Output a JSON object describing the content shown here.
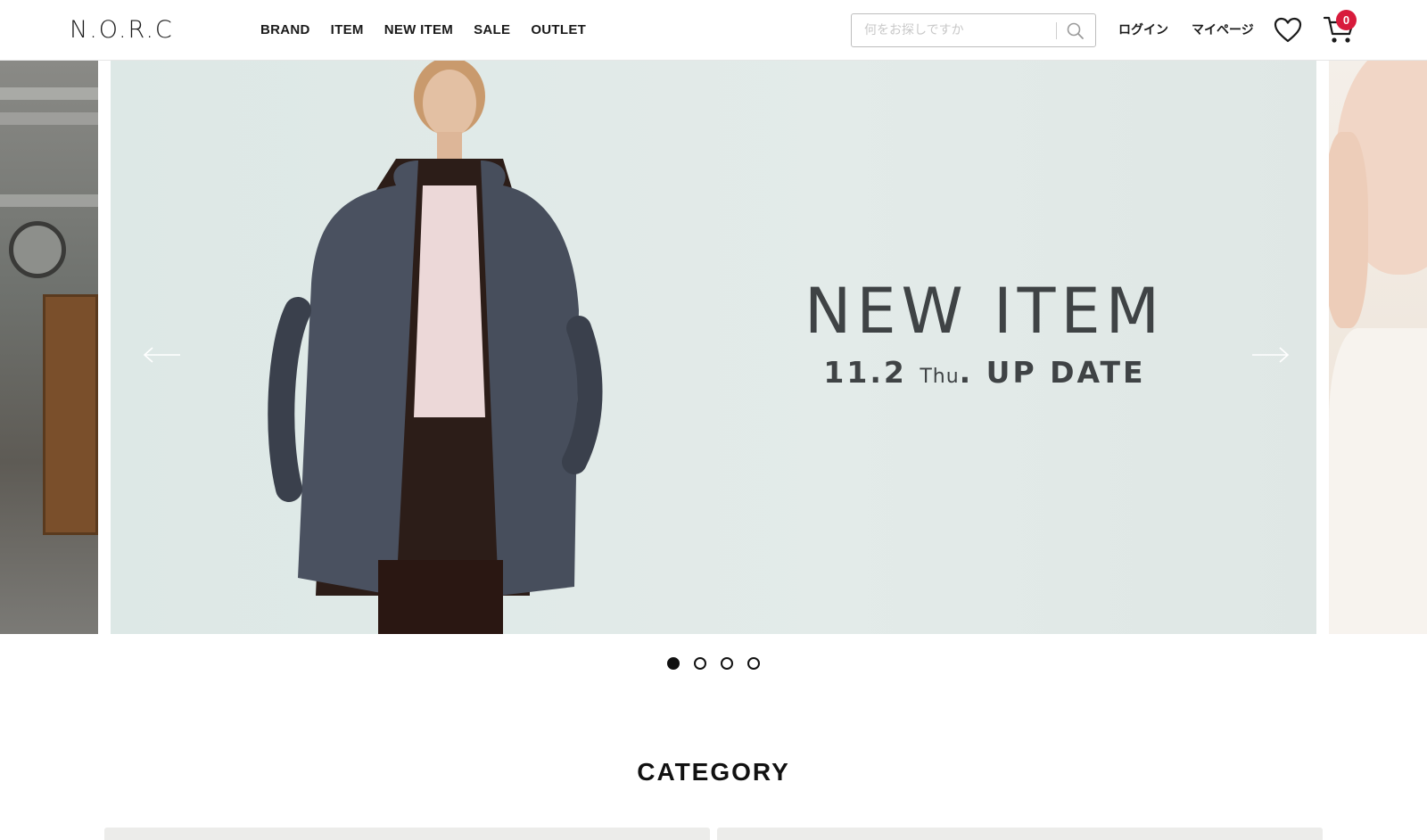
{
  "header": {
    "logo": "N.O.R.C",
    "nav": [
      "BRAND",
      "ITEM",
      "NEW ITEM",
      "SALE",
      "OUTLET"
    ],
    "search": {
      "placeholder": "何をお探しですか"
    },
    "login": "ログイン",
    "mypage": "マイページ",
    "cart_count": "0"
  },
  "hero": {
    "headline": "NEW ITEM",
    "date": "11.2",
    "day": "Thu",
    "suffix": ". UP DATE"
  },
  "carousel": {
    "slide_count": 4,
    "active_index": 0
  },
  "sections": {
    "category_title": "CATEGORY"
  },
  "icons": {
    "search": "search-icon",
    "favorite": "heart-icon",
    "cart": "cart-icon",
    "prev": "arrow-left-icon",
    "next": "arrow-right-icon"
  },
  "colors": {
    "badge": "#d81b3c",
    "hero_bg": "#dde8e6",
    "hero_text": "#3f4345"
  }
}
